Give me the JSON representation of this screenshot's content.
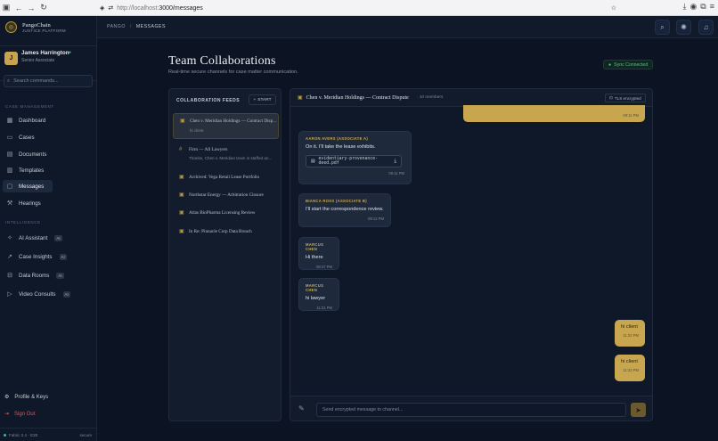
{
  "browser": {
    "url_host": "http://localhost:",
    "url_rest": "3000/messages"
  },
  "brand": {
    "name": "PangoChain",
    "sub": "JUSTICE PLATFORM",
    "logo_letter": "◎"
  },
  "user": {
    "initial": "J",
    "name": "James Harrington",
    "role": "Senior Associate",
    "status_icon": "check-circle-icon"
  },
  "search": {
    "placeholder": "Search commands..."
  },
  "sections": {
    "case": "CASE MANAGEMENT",
    "intel": "INTELLIGENCE"
  },
  "nav": {
    "dashboard": "Dashboard",
    "cases": "Cases",
    "documents": "Documents",
    "templates": "Templates",
    "messages": "Messages",
    "hearings": "Hearings",
    "ai": "AI Assistant",
    "insights": "Case Insights",
    "rooms": "Data Rooms",
    "video": "Video Consults",
    "ai_badge": "AI"
  },
  "footer": {
    "profile": "Profile & Keys",
    "signout": "Sign Out",
    "version": "Fabric 2.4 · E2E",
    "version_right": "secure"
  },
  "breadcrumb": {
    "root": "PANGO",
    "current": "MESSAGES"
  },
  "page": {
    "title": "Team Collaborations",
    "subtitle": "Real-time secure channels for case matter communication.",
    "sync": "Sync Connected"
  },
  "feeds": {
    "header": "COLLABORATION FEEDS",
    "start": "START",
    "items": [
      {
        "title": "Chen v. Meridian Holdings — Contract Disp...",
        "sub": "hi client"
      },
      {
        "title": "Firm — All Lawyers",
        "sub": "Thanks, Chen v. Meridian team is staffed an..."
      },
      {
        "title": "Archived: Vega Retail Lease Portfolio",
        "sub": ""
      },
      {
        "title": "Northstar Energy — Arbitration Closure",
        "sub": ""
      },
      {
        "title": "Atlas BioPharma Licensing Review",
        "sub": ""
      },
      {
        "title": "In Re: Pinnacle Corp Data Breach",
        "sub": ""
      }
    ]
  },
  "chat": {
    "title": "Chen v. Meridian Holdings — Contract Dispute",
    "members": "· 10 members",
    "encryption": "TLS encrypted",
    "messages": [
      {
        "sender": "",
        "text": "",
        "time": "09:11 PM"
      },
      {
        "sender": "AARON AVERS (ASSOCIATE A)",
        "text": "On it. I'll take the lease exhibits.",
        "attachment": "evidentiary-provenance-deed.pdf",
        "time": "09:11 PM"
      },
      {
        "sender": "BIANCA ROSS (ASSOCIATE B)",
        "text": "I'll start the correspondence review.",
        "time": "09:12 PM"
      },
      {
        "sender": "MARCUS CHEN",
        "text": "Hi there",
        "time": "09:47 PM"
      },
      {
        "sender": "MARCUS CHEN",
        "text": "hi lawyer",
        "time": "11:31 PM"
      },
      {
        "sender": "",
        "text": "hi client",
        "time": "11:32 PM"
      },
      {
        "sender": "",
        "text": "hi client",
        "time": "11:33 PM"
      }
    ],
    "input_placeholder": "Send encrypted message to channel..."
  },
  "colors": {
    "accent": "#c8a64f",
    "bg": "#0c1322",
    "success": "#4bc48e"
  }
}
